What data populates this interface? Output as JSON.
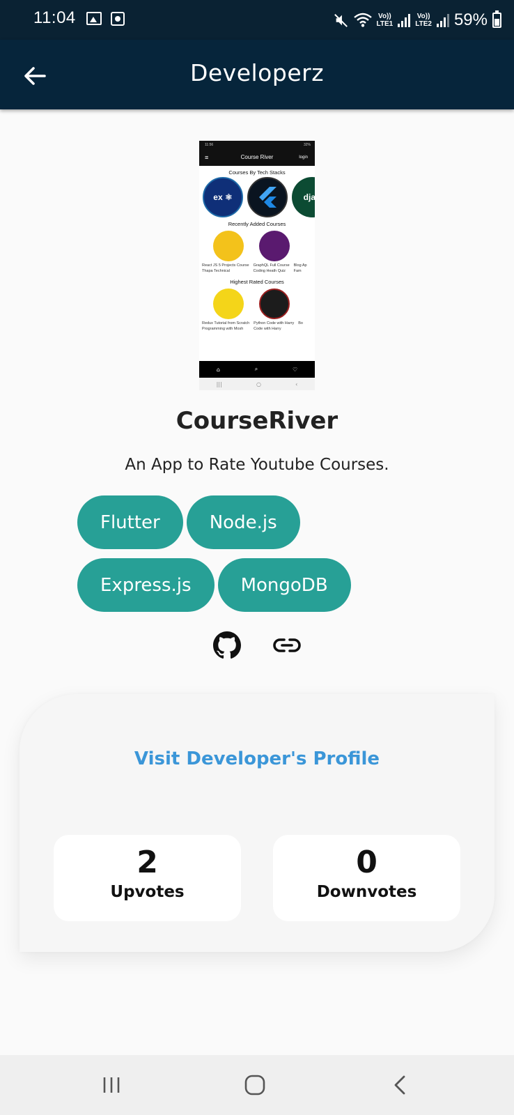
{
  "status_bar": {
    "time": "11:04",
    "lte1": "Vo))\nLTE1",
    "lte2": "Vo))\nLTE2",
    "battery": "59%"
  },
  "app_bar": {
    "title": "Developerz"
  },
  "preview": {
    "app_title": "Course River",
    "login": "login",
    "status_time": "11:56",
    "status_right": "32%",
    "section_tech": "Courses By Tech Stacks",
    "section_recent": "Recently Added Courses",
    "section_rated": "Highest Rated Courses",
    "tech_1": "ex",
    "tech_3": "djan",
    "recent_captions": [
      "React JS 5 Projects Course",
      "GraphQL Full Course",
      "Blog Ap"
    ],
    "recent_captions2": [
      "Thapa Technical",
      "Coding Heath Quiz",
      "Fam"
    ],
    "rated_captions": [
      "Redux Tutorial from Scratch",
      "Python Code with Harry",
      "Bo"
    ],
    "rated_captions2": [
      "Programming with Mosh",
      "Code with Harry",
      ""
    ]
  },
  "project": {
    "name": "CourseRiver",
    "description": "An App to Rate Youtube Courses.",
    "tags": [
      "Flutter",
      "Node.js",
      "Express.js",
      "MongoDB"
    ]
  },
  "links": {
    "github_icon": "github-icon",
    "link_icon": "link-icon"
  },
  "card": {
    "visit_label": "Visit Developer's Profile",
    "upvotes_count": "2",
    "upvotes_label": "Upvotes",
    "downvotes_count": "0",
    "downvotes_label": "Downvotes"
  },
  "colors": {
    "appbar": "#06253b",
    "chip": "#27a096",
    "link": "#3b96d8"
  }
}
